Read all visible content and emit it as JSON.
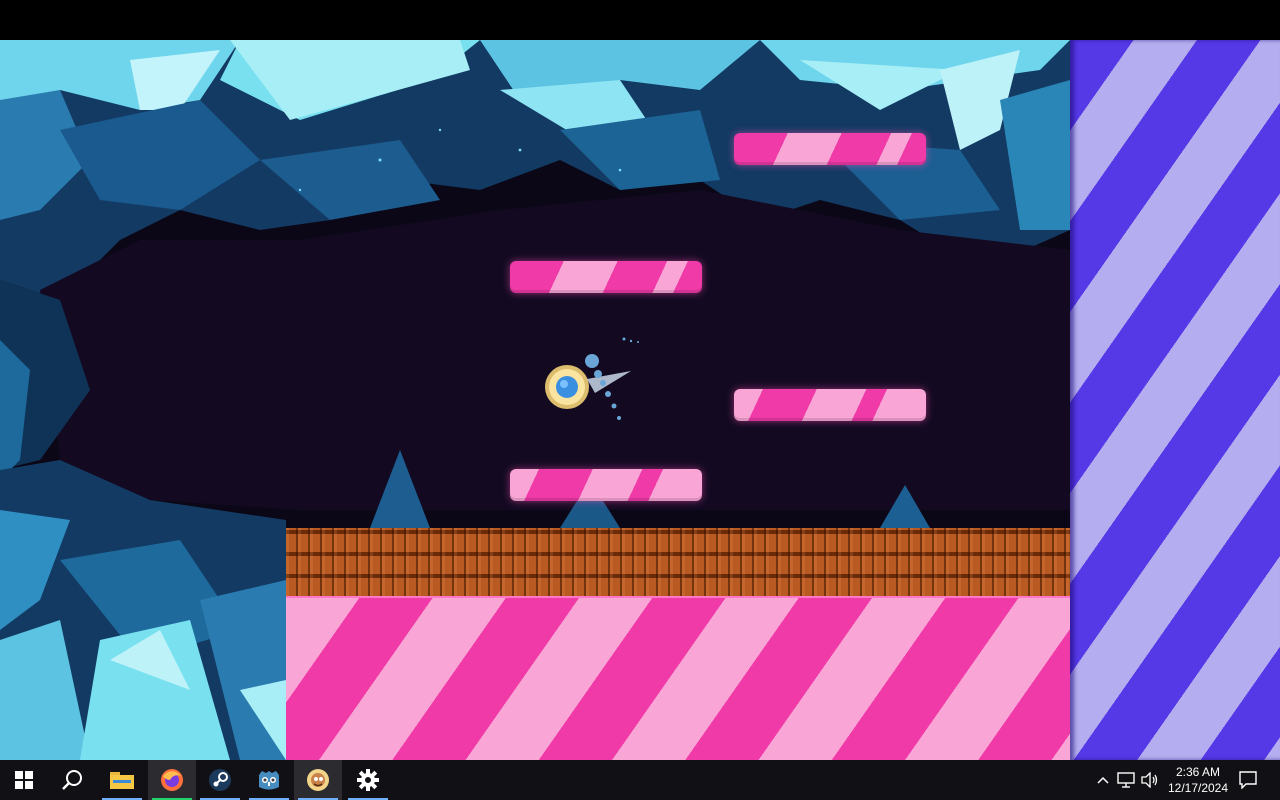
{
  "game": {
    "platform_colors": {
      "dark": "#f03aa8",
      "light": "#f9a6d6"
    },
    "wall_colors": {
      "dark": "#5538e6",
      "light": "#b4aef0"
    },
    "brick_color": "#b85a22",
    "background": "#0b0716",
    "crystal_color": "#4fb6d8"
  },
  "taskbar": {
    "start_icon": "windows-start-icon",
    "search_icon": "search-icon",
    "apps": [
      {
        "icon": "file-explorer-icon"
      },
      {
        "icon": "firefox-icon"
      },
      {
        "icon": "steam-icon"
      },
      {
        "icon": "godot-icon"
      },
      {
        "icon": "game-app-icon"
      },
      {
        "icon": "settings-gear-icon"
      }
    ],
    "tray": {
      "time": "2:36 AM",
      "date": "12/17/2024"
    }
  }
}
